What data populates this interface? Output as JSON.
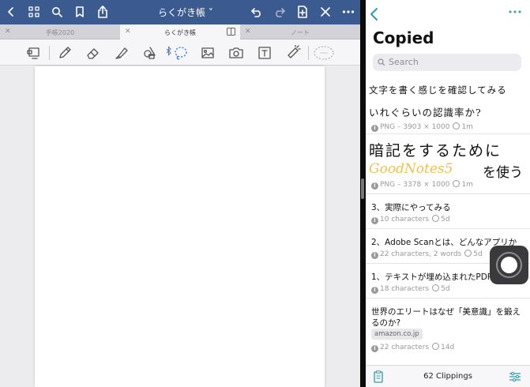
{
  "notes": {
    "document_title": "らくがき帳 ˅",
    "tabs": [
      {
        "label": "手帳2020"
      },
      {
        "label": "らくがき帳"
      },
      {
        "label": "ノート"
      }
    ],
    "nav_icons": [
      "chevron-left-icon",
      "grid-icon",
      "search-icon",
      "bookmark-icon",
      "share-icon",
      "undo-icon",
      "redo-icon",
      "add-page-icon",
      "close-icon",
      "more-icon"
    ],
    "tool_icons": [
      "presentation-icon",
      "pen-icon",
      "eraser-icon",
      "highlighter-icon",
      "shapes-icon",
      "lasso-icon",
      "image-icon",
      "camera-icon",
      "text-icon",
      "laser-pointer-icon",
      "elements-icon"
    ],
    "accent_color": "#3b5a90"
  },
  "clipboard": {
    "title": "Copied",
    "search_placeholder": "Search",
    "clips": [
      {
        "handwriting_line1": "文字を書く感じを確認してみる",
        "handwriting_line2": "いれぐらいの認識率か?",
        "meta_type": "PNG – 3903 × 1000",
        "meta_time": "1m"
      },
      {
        "handwriting_line1": "暗記をするために",
        "handwriting_line2_highlight": "GoodNotes5",
        "handwriting_line2_rest": "を使う",
        "meta_type": "PNG – 3378 × 1000",
        "meta_time": "1m"
      },
      {
        "text": "3、実際にやってみる",
        "meta_type": "10 characters",
        "meta_time": "5d"
      },
      {
        "text": "2、Adobe Scanとは、どんなアプリか",
        "meta_type": "22 characters, 2 words",
        "meta_time": "5d"
      },
      {
        "text": "1、テキストが埋め込まれたPDF",
        "meta_type": "18 characters",
        "meta_time": "5d"
      },
      {
        "text_line1": "世界のエリートはなぜ「美意識」を鍛え",
        "text_line2": "るのか?",
        "tag": "amazon.co.jp",
        "meta_type": "22 characters",
        "meta_time": "14d"
      }
    ],
    "clip_count": "62 Clippings",
    "highlight_color": "#f0c14b"
  }
}
